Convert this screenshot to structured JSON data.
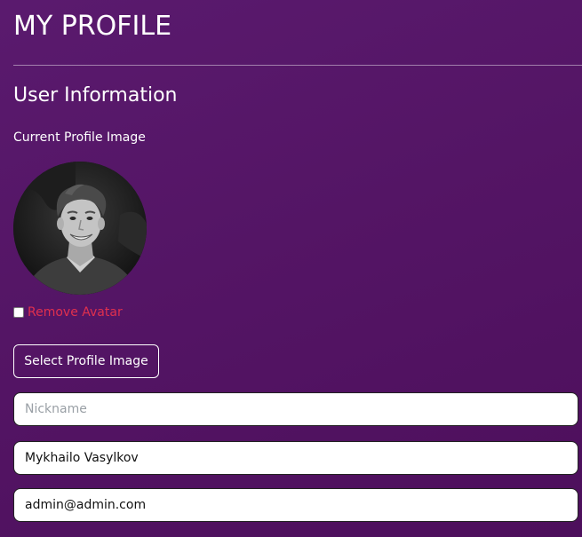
{
  "header": {
    "title": "MY PROFILE"
  },
  "section": {
    "title": "User Information"
  },
  "profile_image": {
    "label": "Current Profile Image",
    "avatar_icon": "avatar-photo"
  },
  "remove_avatar": {
    "label": "Remove Avatar",
    "checked": false
  },
  "select_image_button": {
    "label": "Select Profile Image"
  },
  "form": {
    "nickname": {
      "value": "",
      "placeholder": "Nickname"
    },
    "full_name": {
      "value": "Mykhailo Vasylkov",
      "placeholder": ""
    },
    "email": {
      "value": "admin@admin.com",
      "placeholder": ""
    }
  },
  "colors": {
    "background": "#541565",
    "remove_text": "#e0304e",
    "text": "#ffffff"
  }
}
